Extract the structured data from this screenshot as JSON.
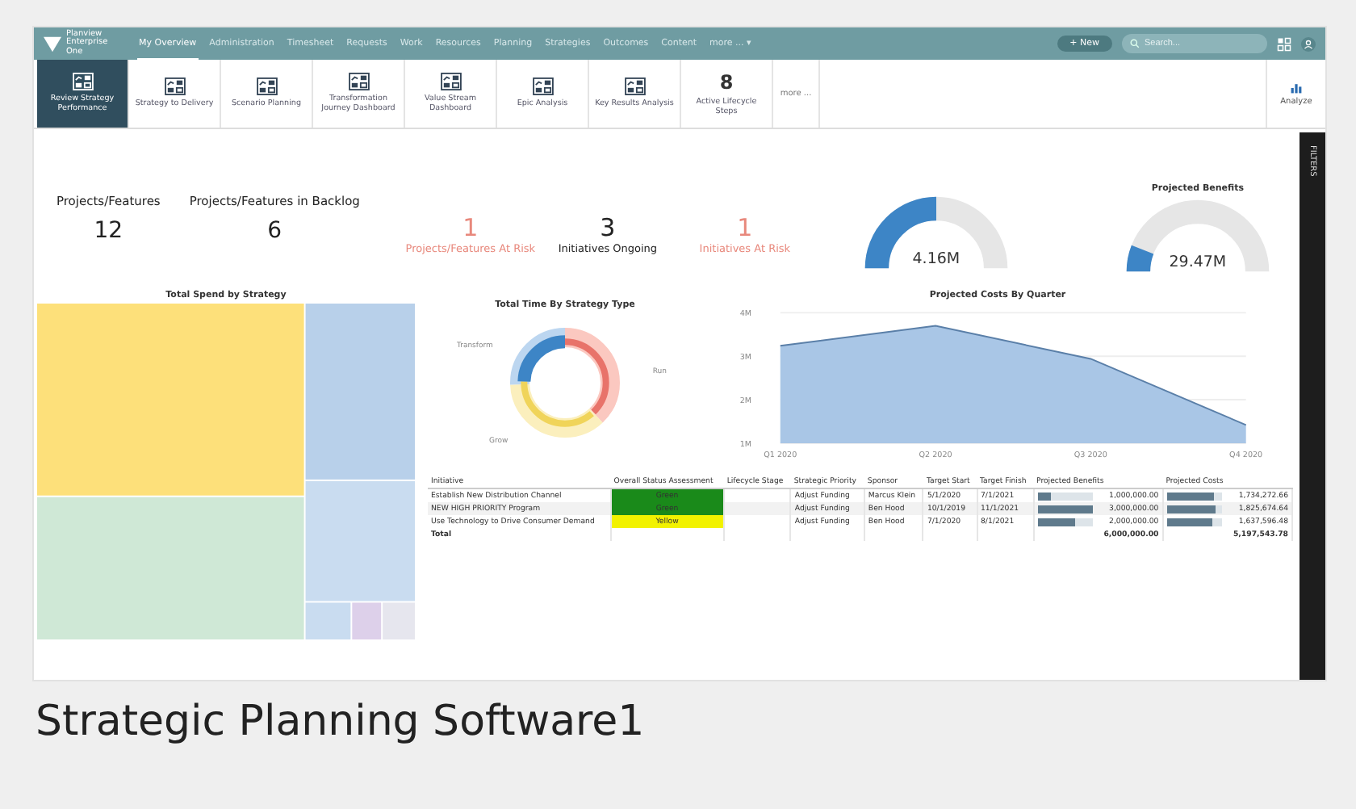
{
  "app": {
    "logo": "Planview Enterprise One",
    "nav": [
      {
        "label": "My Overview",
        "selected": true
      },
      {
        "label": "Administration",
        "selected": false
      },
      {
        "label": "Timesheet",
        "selected": false
      },
      {
        "label": "Requests",
        "selected": false
      },
      {
        "label": "Work",
        "selected": false
      },
      {
        "label": "Resources",
        "selected": false
      },
      {
        "label": "Planning",
        "selected": false
      },
      {
        "label": "Strategies",
        "selected": false
      },
      {
        "label": "Outcomes",
        "selected": false
      },
      {
        "label": "Content",
        "selected": false
      },
      {
        "label": "more ... ▾",
        "selected": false
      }
    ],
    "new_button": "+ New",
    "search": {
      "placeholder": "Search..."
    }
  },
  "tiles": [
    {
      "kind": "report",
      "label": "Review Strategy Performance",
      "selected": true
    },
    {
      "kind": "report",
      "label": "Strategy to Delivery",
      "selected": false
    },
    {
      "kind": "report",
      "label": "Scenario Planning",
      "selected": false
    },
    {
      "kind": "report",
      "label": "Transformation Journey Dashboard",
      "selected": false
    },
    {
      "kind": "report",
      "label": "Value Stream Dashboard",
      "selected": false
    },
    {
      "kind": "report",
      "label": "Epic Analysis",
      "selected": false
    },
    {
      "kind": "report",
      "label": "Key Results Analysis",
      "selected": false
    },
    {
      "kind": "count",
      "value": "8",
      "label": "Active Lifecycle Steps",
      "selected": false
    },
    {
      "kind": "more",
      "label": "more ...",
      "selected": false
    }
  ],
  "analyze": "Analyze",
  "filters": "FILTERS",
  "kpis": [
    {
      "label": "Projects/Features",
      "value": "12",
      "risk": false
    },
    {
      "label": "Projects/Features in Backlog",
      "value": "6",
      "risk": false
    }
  ],
  "kpis2": [
    {
      "value": "1",
      "label": "Projects/Features At Risk",
      "risk": true
    },
    {
      "value": "3",
      "label": "Initiatives Ongoing",
      "risk": false
    },
    {
      "value": "1",
      "label": "Initiatives At Risk",
      "risk": true
    }
  ],
  "gauges": [
    {
      "value": "4.16M"
    },
    {
      "title": "Projected Benefits",
      "value": "29.47M"
    }
  ],
  "treemap": {
    "title": "Total Spend by Strategy"
  },
  "donut": {
    "title": "Total Time By Strategy Type",
    "labels": [
      "Transform",
      "Run",
      "Grow"
    ]
  },
  "area": {
    "chart_data": {
      "type": "area",
      "title": "Projected Costs By Quarter",
      "categories": [
        "Q1 2020",
        "Q2 2020",
        "Q3 2020",
        "Q4 2020"
      ],
      "values": [
        3.24,
        3.7,
        2.94,
        1.42
      ],
      "ylim": [
        1,
        4
      ],
      "yticks": [
        {
          "value": 1,
          "label": "1M"
        },
        {
          "value": 2,
          "label": "2M"
        },
        {
          "value": 3,
          "label": "3M"
        },
        {
          "value": 4,
          "label": "4M"
        }
      ]
    }
  },
  "table": {
    "columns": [
      "Initiative",
      "Overall Status Assessment",
      "Lifecycle Stage",
      "Strategic Priority",
      "Sponsor",
      "Target Start",
      "Target Finish",
      "Projected Benefits",
      "Projected Costs"
    ],
    "rows": [
      {
        "initiative": "Establish New Distribution Channel",
        "status": "Green",
        "color": "#1a8a1a",
        "priority": "Adjust Funding",
        "sponsor": "Marcus Klein",
        "start": "5/1/2020",
        "finish": "7/1/2021",
        "benefits": {
          "text": "1,000,000.00",
          "level": 0.25
        },
        "costs": {
          "text": "1,734,272.66",
          "level": 0.87
        }
      },
      {
        "initiative": "NEW HIGH PRIORITY Program",
        "status": "Green",
        "color": "#1a8a1a",
        "priority": "Adjust Funding",
        "sponsor": "Ben Hood",
        "start": "10/1/2019",
        "finish": "11/1/2021",
        "benefits": {
          "text": "3,000,000.00",
          "level": 1
        },
        "costs": {
          "text": "1,825,674.64",
          "level": 0.9
        }
      },
      {
        "initiative": "Use Technology to Drive Consumer Demand",
        "status": "Yellow",
        "color": "#f2f200",
        "priority": "Adjust Funding",
        "sponsor": "Ben Hood",
        "start": "7/1/2020",
        "finish": "8/1/2021",
        "benefits": {
          "text": "2,000,000.00",
          "level": 0.7
        },
        "costs": {
          "text": "1,637,596.48",
          "level": 0.82
        }
      }
    ],
    "total": {
      "label": "Total",
      "benefits": "6,000,000.00",
      "costs": "5,197,543.78"
    }
  },
  "caption": "Strategic Planning Software1"
}
